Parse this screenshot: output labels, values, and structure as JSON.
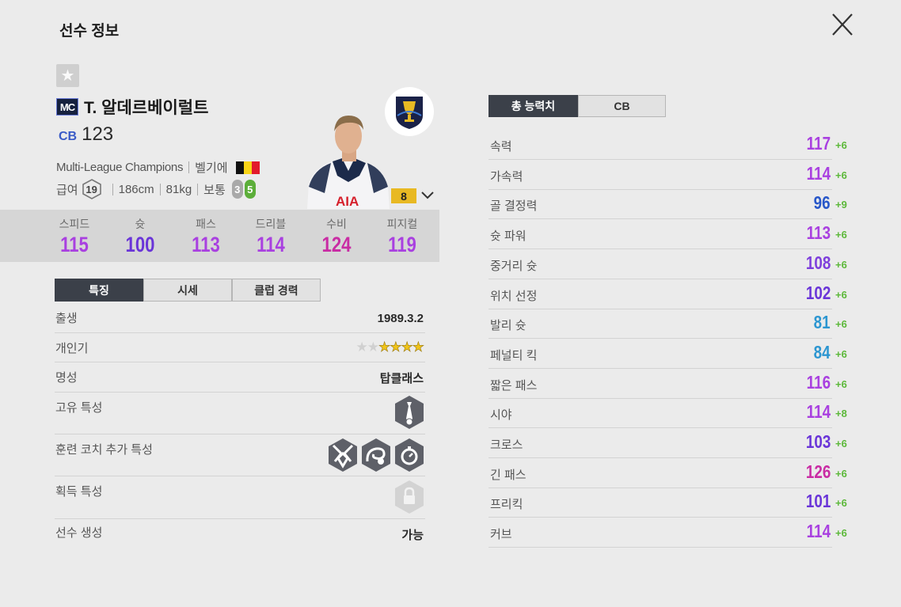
{
  "title": "선수 정보",
  "player": {
    "season_badge": "MC",
    "name": "T. 알데르베이럴트",
    "position": "CB",
    "overall": "123",
    "season": "Multi-League Champions",
    "nation": "벨기에",
    "salary_label": "급여",
    "salary": "19",
    "height": "186cm",
    "weight": "81kg",
    "body_type": "보통",
    "weak_foot": "3",
    "strong_foot": "5",
    "grade": "8"
  },
  "summary_stats": [
    {
      "label": "스피드",
      "value": "115",
      "color": "#a940e0"
    },
    {
      "label": "슛",
      "value": "100",
      "color": "#6a35d8"
    },
    {
      "label": "패스",
      "value": "113",
      "color": "#a940e0"
    },
    {
      "label": "드리블",
      "value": "114",
      "color": "#a940e0"
    },
    {
      "label": "수비",
      "value": "124",
      "color": "#c92ca4"
    },
    {
      "label": "피지컬",
      "value": "119",
      "color": "#a940e0"
    }
  ],
  "left_tabs": [
    "특징",
    "시세",
    "클럽 경력"
  ],
  "info": {
    "birth_label": "출생",
    "birth": "1989.3.2",
    "popularity_label": "개인기",
    "popularity_stars_filled": 4,
    "popularity_stars_total": 6,
    "fame_label": "명성",
    "fame": "탑클래스",
    "unique_trait_label": "고유 특성",
    "coach_trait_label": "훈련 코치 추가 특성",
    "acquired_trait_label": "획득 특성",
    "create_label": "선수 생성",
    "create": "가능"
  },
  "right_tabs": [
    "총 능력치",
    "CB"
  ],
  "abilities": [
    {
      "label": "속력",
      "value": "117",
      "bonus": "+6",
      "color": "#a940e0"
    },
    {
      "label": "가속력",
      "value": "114",
      "bonus": "+6",
      "color": "#a940e0"
    },
    {
      "label": "골 결정력",
      "value": "96",
      "bonus": "+9",
      "color": "#2857c9"
    },
    {
      "label": "슛 파워",
      "value": "113",
      "bonus": "+6",
      "color": "#a940e0"
    },
    {
      "label": "중거리 슛",
      "value": "108",
      "bonus": "+6",
      "color": "#7e3fdc"
    },
    {
      "label": "위치 선정",
      "value": "102",
      "bonus": "+6",
      "color": "#6a35d8"
    },
    {
      "label": "발리 슛",
      "value": "81",
      "bonus": "+6",
      "color": "#2c96d1"
    },
    {
      "label": "페널티 킥",
      "value": "84",
      "bonus": "+6",
      "color": "#2c96d1"
    },
    {
      "label": "짧은 패스",
      "value": "116",
      "bonus": "+6",
      "color": "#a940e0"
    },
    {
      "label": "시야",
      "value": "114",
      "bonus": "+8",
      "color": "#a940e0"
    },
    {
      "label": "크로스",
      "value": "103",
      "bonus": "+6",
      "color": "#6a35d8"
    },
    {
      "label": "긴 패스",
      "value": "126",
      "bonus": "+6",
      "color": "#c92ca4"
    },
    {
      "label": "프리킥",
      "value": "101",
      "bonus": "+6",
      "color": "#6a35d8"
    },
    {
      "label": "커브",
      "value": "114",
      "bonus": "+6",
      "color": "#a940e0"
    }
  ]
}
